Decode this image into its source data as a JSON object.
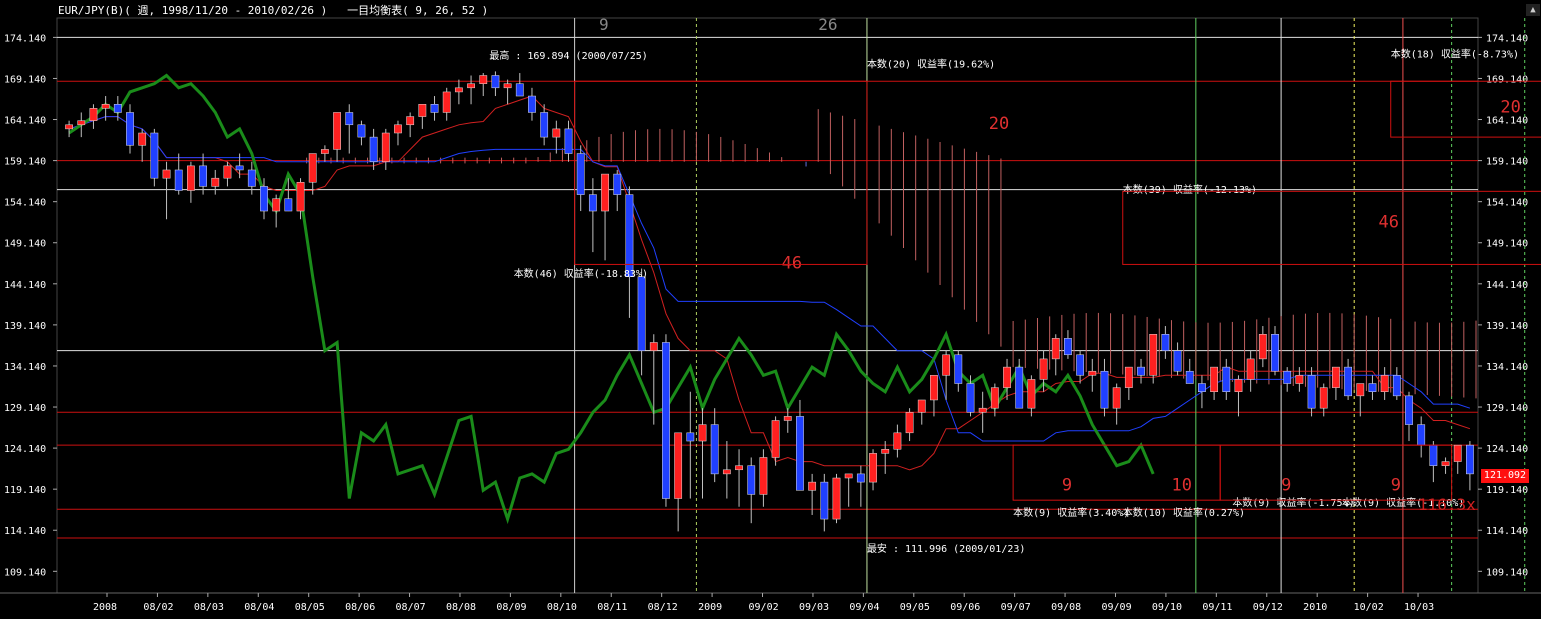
{
  "header": {
    "symbol": "EUR/JPY(B)( 週, 1998/11/20 - 2010/02/26 )",
    "indicator": "一目均衡表( 9, 26, 52 )"
  },
  "price_label": "121.092",
  "magnify_label": "116.3x",
  "colors": {
    "background": "#000000",
    "up_candle": "#ff2020",
    "down_candle": "#2040ff",
    "chikou": "#1a8c1a",
    "hline": "#cc1010",
    "grid": "#ffffff",
    "cloud_up": "#c06060",
    "cloud_down": "#6070e0",
    "close_label": "#ff1010"
  },
  "chart_data": {
    "type": "candlestick",
    "y_ticks": [
      "174.140",
      "169.140",
      "164.140",
      "159.140",
      "154.140",
      "149.140",
      "144.140",
      "139.140",
      "134.140",
      "129.140",
      "124.140",
      "119.140",
      "114.140",
      "109.140"
    ],
    "ylim": [
      106.5,
      176.5
    ],
    "x_ticks": [
      "2008",
      "08/02",
      "08/03",
      "08/04",
      "08/05",
      "08/06",
      "08/07",
      "08/08",
      "08/09",
      "08/10",
      "08/11",
      "08/12",
      "2009",
      "09/02",
      "09/03",
      "09/04",
      "09/05",
      "09/06",
      "09/07",
      "09/08",
      "09/09",
      "09/10",
      "09/11",
      "09/12",
      "2010",
      "10/02",
      "10/03"
    ],
    "candles": [
      [
        163,
        164,
        162,
        163.5
      ],
      [
        163.5,
        165,
        162,
        164
      ],
      [
        164,
        166,
        163,
        165.5
      ],
      [
        165.5,
        167,
        164,
        166
      ],
      [
        166,
        167,
        164,
        165
      ],
      [
        165,
        166,
        160,
        161
      ],
      [
        161,
        163,
        159,
        162.5
      ],
      [
        162.5,
        163,
        156,
        157
      ],
      [
        157,
        159,
        152,
        158
      ],
      [
        158,
        160,
        155,
        155.5
      ],
      [
        155.5,
        159,
        154,
        158.5
      ],
      [
        158.5,
        160,
        155,
        156
      ],
      [
        156,
        158,
        155,
        157
      ],
      [
        157,
        159,
        156,
        158.5
      ],
      [
        158.5,
        160,
        157,
        158
      ],
      [
        158,
        159,
        155,
        156
      ],
      [
        156,
        157,
        152,
        153
      ],
      [
        153,
        155,
        151,
        154.5
      ],
      [
        154.5,
        157,
        153,
        153
      ],
      [
        153,
        157,
        152,
        156.5
      ],
      [
        156.5,
        160,
        155,
        160
      ],
      [
        160,
        161,
        159,
        160.5
      ],
      [
        160.5,
        165,
        159,
        165
      ],
      [
        165,
        166,
        160,
        163.5
      ],
      [
        163.5,
        164,
        161,
        162
      ],
      [
        162,
        163,
        158,
        159
      ],
      [
        159,
        163,
        158,
        162.5
      ],
      [
        162.5,
        164,
        161,
        163.5
      ],
      [
        163.5,
        165,
        162,
        164.5
      ],
      [
        164.5,
        166,
        163,
        166
      ],
      [
        166,
        167,
        164,
        165
      ],
      [
        165,
        168,
        164,
        167.5
      ],
      [
        167.5,
        169,
        166,
        168
      ],
      [
        168,
        169.5,
        166,
        168.5
      ],
      [
        168.5,
        169.8,
        167,
        169.5
      ],
      [
        169.5,
        170,
        167,
        168
      ],
      [
        168,
        169,
        166,
        168.5
      ],
      [
        168.5,
        169.8,
        167,
        167
      ],
      [
        167,
        168,
        164,
        165
      ],
      [
        165,
        166,
        161,
        162
      ],
      [
        162,
        164,
        160,
        163
      ],
      [
        163,
        164,
        159,
        160
      ],
      [
        160,
        161,
        153,
        155
      ],
      [
        155,
        157,
        148,
        153
      ],
      [
        153,
        157,
        147,
        157.5
      ],
      [
        157.5,
        158,
        153,
        155
      ],
      [
        155,
        156,
        140,
        145
      ],
      [
        145,
        146,
        133,
        136
      ],
      [
        136,
        138,
        127,
        137
      ],
      [
        137,
        138,
        117,
        118
      ],
      [
        118,
        126,
        114,
        126
      ],
      [
        126,
        131,
        118,
        125
      ],
      [
        125,
        129,
        118,
        127
      ],
      [
        127,
        129,
        120,
        121
      ],
      [
        121,
        125,
        118,
        121.5
      ],
      [
        121.5,
        124,
        117,
        122
      ],
      [
        122,
        123,
        115,
        118.5
      ],
      [
        118.5,
        124,
        117,
        123
      ],
      [
        123,
        128,
        122,
        127.5
      ],
      [
        127.5,
        129,
        126,
        128
      ],
      [
        128,
        130,
        119,
        119
      ],
      [
        119,
        121,
        116,
        120
      ],
      [
        120,
        121,
        114,
        115.5
      ],
      [
        115.5,
        121,
        115,
        120.5
      ],
      [
        120.5,
        121,
        117,
        121
      ],
      [
        121,
        122,
        117,
        120
      ],
      [
        120,
        124,
        119,
        123.5
      ],
      [
        123.5,
        125,
        121,
        124
      ],
      [
        124,
        127,
        123,
        126
      ],
      [
        126,
        129,
        125,
        128.5
      ],
      [
        128.5,
        130,
        127,
        130
      ],
      [
        130,
        132,
        128,
        133
      ],
      [
        133,
        136,
        130,
        135.5
      ],
      [
        135.5,
        136,
        131,
        132
      ],
      [
        132,
        133,
        128,
        128.5
      ],
      [
        128.5,
        131,
        126,
        129
      ],
      [
        129,
        132,
        128,
        131.5
      ],
      [
        131.5,
        135,
        130,
        134
      ],
      [
        134,
        135,
        129,
        129
      ],
      [
        129,
        133,
        128,
        132.5
      ],
      [
        132.5,
        136,
        131,
        135
      ],
      [
        135,
        138,
        133,
        137.5
      ],
      [
        137.5,
        138.5,
        135,
        135.5
      ],
      [
        135.5,
        136,
        132,
        133
      ],
      [
        133,
        135,
        131,
        133.5
      ],
      [
        133.5,
        135,
        128,
        129
      ],
      [
        129,
        132,
        127,
        131.5
      ],
      [
        131.5,
        134,
        130,
        134
      ],
      [
        134,
        135,
        132,
        133
      ],
      [
        133,
        138,
        132,
        138
      ],
      [
        138,
        139,
        135,
        136
      ],
      [
        136,
        137,
        133,
        133.5
      ],
      [
        133.5,
        135,
        132,
        132
      ],
      [
        132,
        133,
        129,
        131
      ],
      [
        131,
        134,
        130,
        134
      ],
      [
        134,
        135,
        130,
        131
      ],
      [
        131,
        133,
        128,
        132.5
      ],
      [
        132.5,
        136,
        131,
        135
      ],
      [
        135,
        139,
        134,
        138
      ],
      [
        138,
        139,
        133,
        133.5
      ],
      [
        133.5,
        134,
        131,
        132
      ],
      [
        132,
        134,
        131,
        133
      ],
      [
        133,
        134,
        128,
        129
      ],
      [
        129,
        132,
        128,
        131.5
      ],
      [
        131.5,
        134,
        130,
        134
      ],
      [
        134,
        135,
        130,
        130.5
      ],
      [
        130.5,
        132,
        128,
        132
      ],
      [
        132,
        133,
        130,
        131
      ],
      [
        131,
        134,
        130,
        133
      ],
      [
        133,
        134,
        130,
        130.5
      ],
      [
        130.5,
        131,
        125,
        127
      ],
      [
        127,
        128,
        123,
        124.5
      ],
      [
        124.5,
        125,
        120,
        122
      ],
      [
        122,
        123,
        121,
        122.5
      ],
      [
        122.5,
        124,
        121,
        124.5
      ],
      [
        124.5,
        125,
        119,
        121
      ]
    ],
    "horizontal_lines": [
      174.14,
      168.8,
      159.14,
      155.6,
      136.0,
      128.5,
      124.5,
      116.7,
      113.2
    ],
    "annotations": [
      {
        "text": "最高 : 169.894 (2000/07/25)",
        "x": 35,
        "y": 171.5
      },
      {
        "text": "最安 : 111.996 (2009/01/23)",
        "x": 66,
        "y": 111.5
      },
      {
        "text": "本数(20) 収益率(19.62%)",
        "x": 66,
        "y": 170.5
      },
      {
        "text": "本数(46) 収益率(-18.83%)",
        "x": 37,
        "y": 145.0
      },
      {
        "text": "本数(39) 収益率(-12.13%)",
        "x": 87,
        "y": 155.2
      },
      {
        "text": "本数(18) 収益率(-8.73%)",
        "x": 109,
        "y": 171.7
      },
      {
        "text": "本数(9) 収益率(3.40%)",
        "x": 78,
        "y": 115.9
      },
      {
        "text": "本数(10) 収益率(0.27%)",
        "x": 87,
        "y": 115.9
      },
      {
        "text": "本数(9) 収益率(-1.75%)",
        "x": 96,
        "y": 117.1
      },
      {
        "text": "本数(9) 収益率(-1.10%)",
        "x": 105,
        "y": 117.1
      }
    ],
    "count_labels": [
      {
        "text": "20",
        "x": 76,
        "y": 163
      },
      {
        "text": "46",
        "x": 59,
        "y": 146
      },
      {
        "text": "46",
        "x": 108,
        "y": 151
      },
      {
        "text": "20",
        "x": 118,
        "y": 165
      },
      {
        "text": "9",
        "x": 82,
        "y": 119
      },
      {
        "text": "10",
        "x": 91,
        "y": 119
      },
      {
        "text": "9",
        "x": 100,
        "y": 119
      },
      {
        "text": "9",
        "x": 109,
        "y": 119
      }
    ],
    "top_labels": [
      {
        "text": "9",
        "x": 44
      },
      {
        "text": "26",
        "x": 62
      }
    ]
  }
}
